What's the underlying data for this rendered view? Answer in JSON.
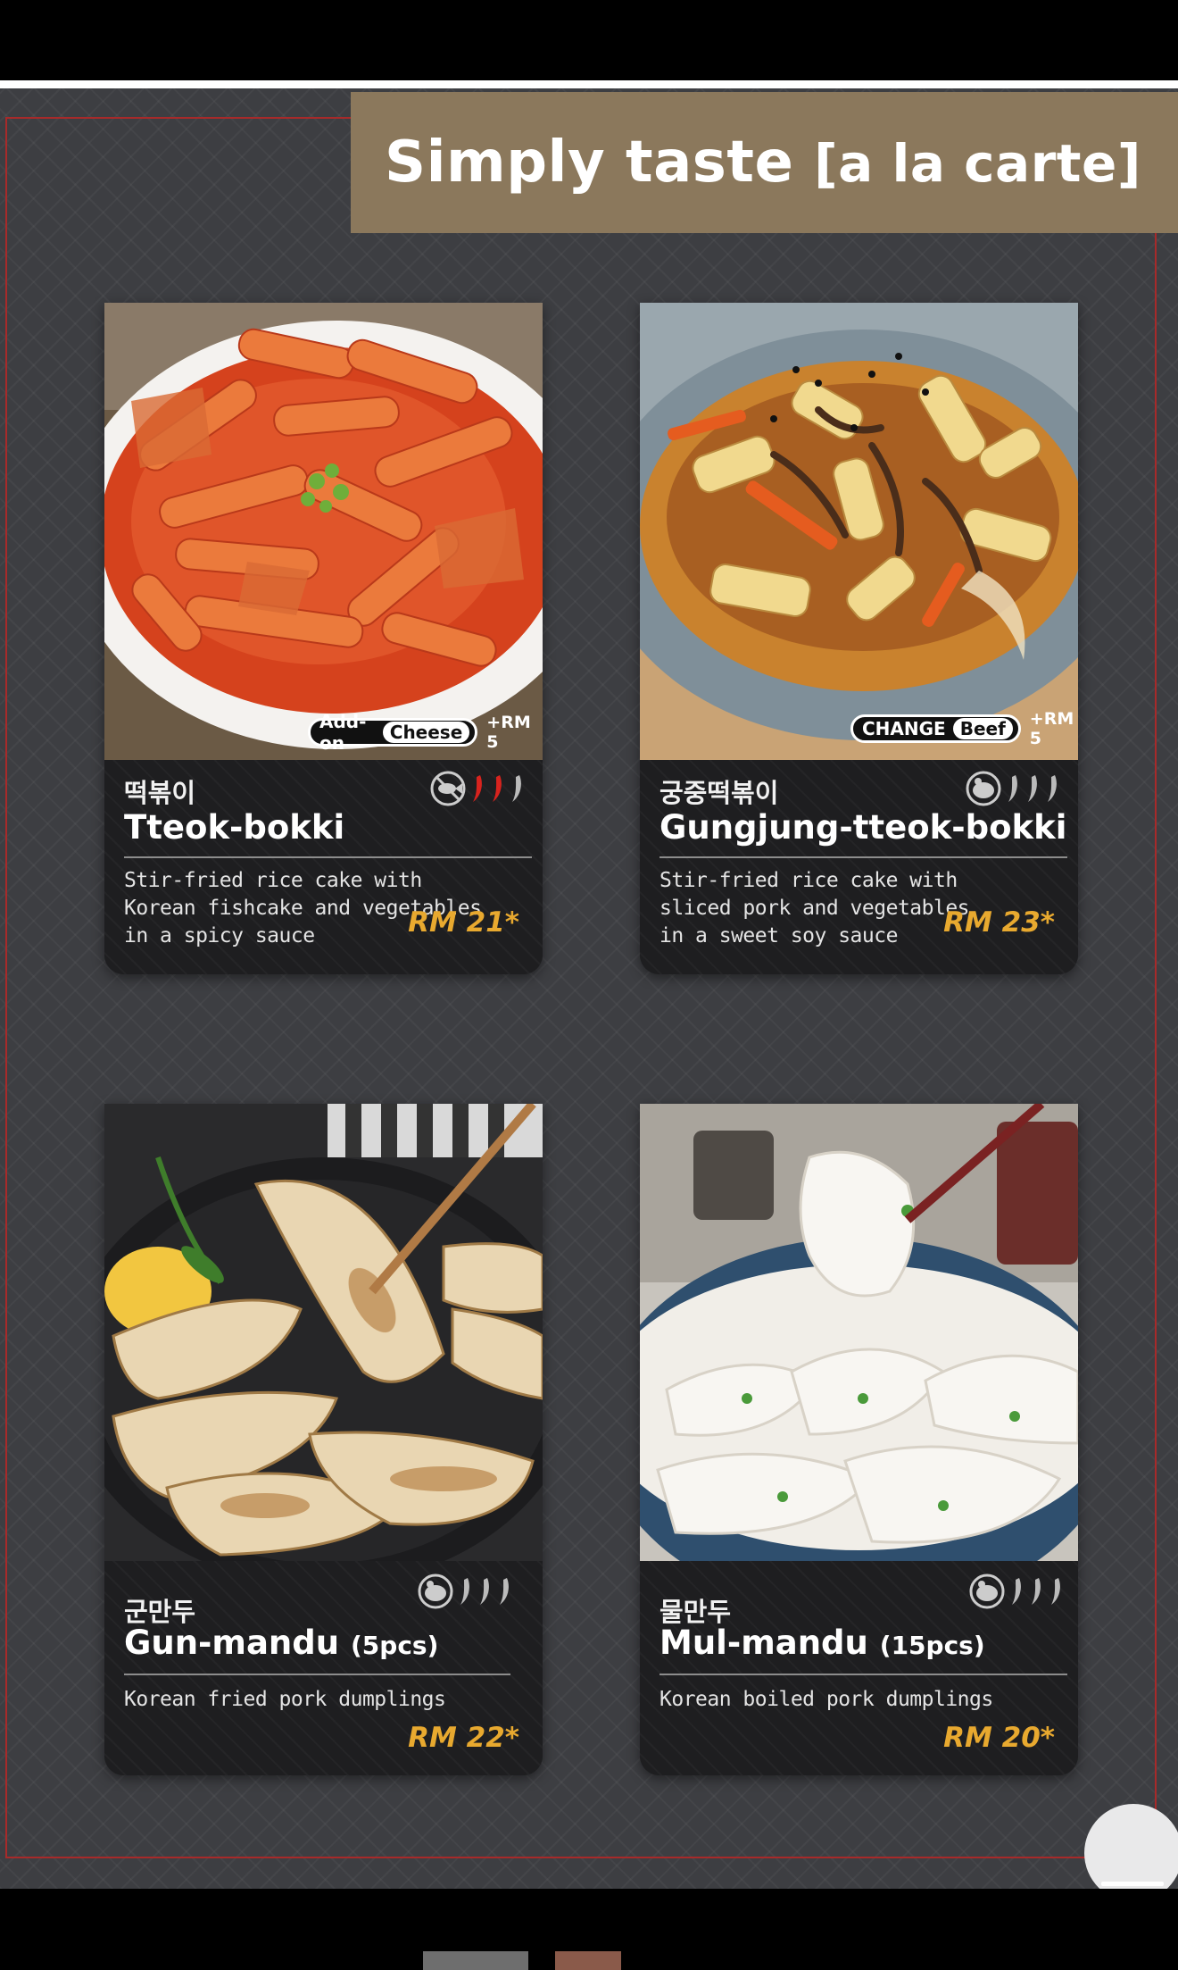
{
  "banner": {
    "title": "Simply taste",
    "subtitle": "[a la carte]"
  },
  "items": [
    {
      "korean": "떡볶이",
      "name": "Tteok-bokki",
      "pcs": "",
      "description": [
        "Stir-fried rice cake with",
        "Korean fishcake and vegetables",
        "in a spicy sauce"
      ],
      "price": "RM 21*",
      "badge": {
        "label": "Add-on",
        "option": "Cheese",
        "extra": "+RM 5"
      },
      "spice_level": 2,
      "protein_icon": "fish-icon"
    },
    {
      "korean": "궁중떡볶이",
      "name": "Gungjung-tteok-bokki",
      "pcs": "",
      "description": [
        "Stir-fried rice cake with",
        "sliced pork and vegetables",
        "in a sweet soy sauce"
      ],
      "price": "RM 23*",
      "badge": {
        "label": "CHANGE",
        "option": "Beef",
        "extra": "+RM 5"
      },
      "spice_level": 0,
      "protein_icon": "pork-icon"
    },
    {
      "korean": "군만두",
      "name": "Gun-mandu",
      "pcs": "(5pcs)",
      "description": [
        "Korean fried pork dumplings"
      ],
      "price": "RM 22*",
      "spice_level": 0,
      "protein_icon": "pork-icon"
    },
    {
      "korean": "물만두",
      "name": "Mul-mandu",
      "pcs": "(15pcs)",
      "description": [
        "Korean boiled pork dumplings"
      ],
      "price": "RM 20*",
      "spice_level": 0,
      "protein_icon": "pork-icon"
    }
  ],
  "colors": {
    "banner": "#8b785c",
    "price": "#e8a92f",
    "chili": "#d8231e",
    "frame": "#a72a2a"
  }
}
